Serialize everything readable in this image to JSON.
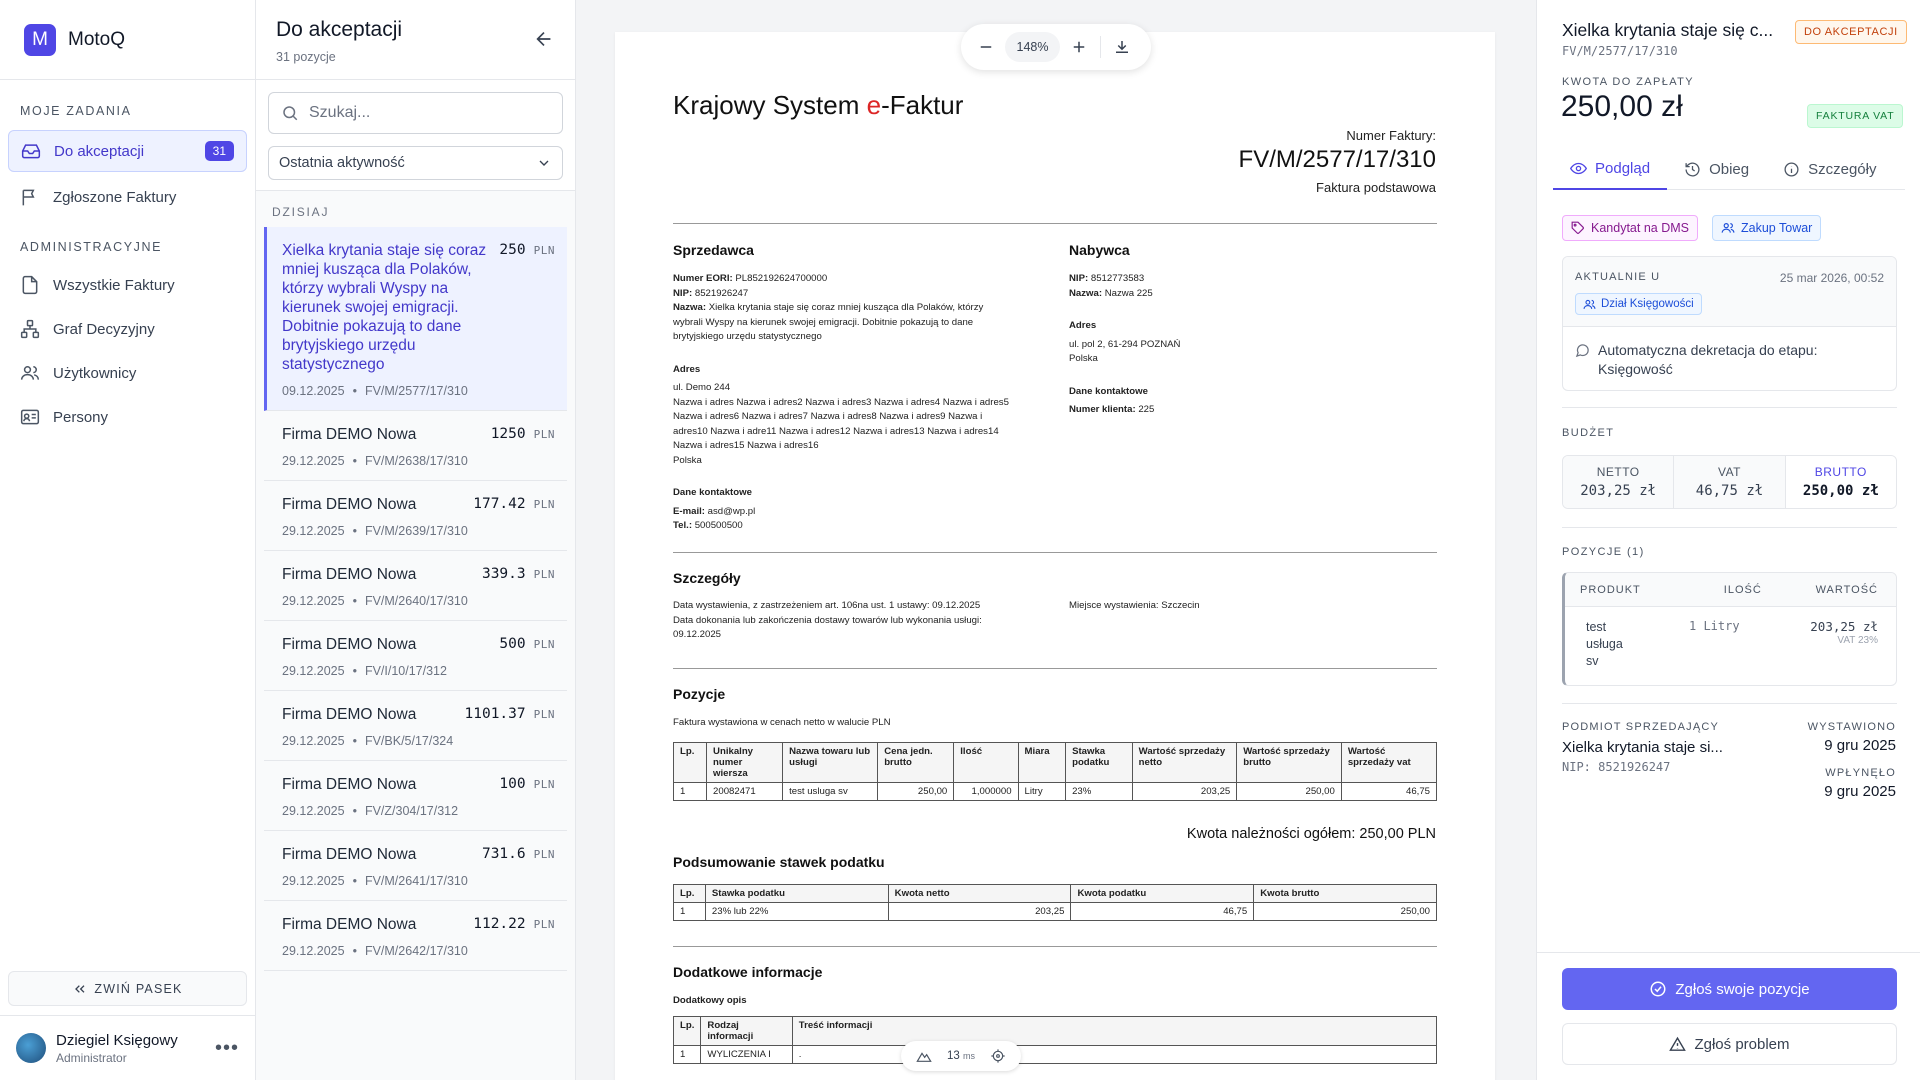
{
  "app": {
    "logo_letter": "M",
    "name": "MotoQ",
    "accent": "#4f46e5"
  },
  "sidebar": {
    "section_tasks": "MOJE ZADANIA",
    "tasks": [
      {
        "label": "Do akceptacji",
        "count": "31",
        "icon": "inbox-icon",
        "active": true
      },
      {
        "label": "Zgłoszone Faktury",
        "icon": "flag-icon"
      }
    ],
    "section_admin": "ADMINISTRACYJNE",
    "admin": [
      {
        "label": "Wszystkie Faktury",
        "icon": "file-icon"
      },
      {
        "label": "Graf Decyzyjny",
        "icon": "network-icon"
      },
      {
        "label": "Użytkownicy",
        "icon": "users-icon"
      },
      {
        "label": "Persony",
        "icon": "id-card-icon"
      }
    ],
    "collapse_label": "ZWIŃ PASEK",
    "user": {
      "name": "Dziegiel Księgowy",
      "role": "Administrator"
    }
  },
  "list": {
    "title": "Do akceptacji",
    "subtitle": "31 pozycje",
    "search_placeholder": "Szukaj...",
    "sort_value": "Ostatnia aktywność",
    "group_label": "DZISIAJ",
    "items": [
      {
        "title": "Xielka krytania staje się coraz mniej kusząca dla Polaków, którzy wybrali Wyspy na kierunek swojej emigracji. Dobitnie pokazują to dane brytyjskiego urzędu statystycznego",
        "amount": "250",
        "currency": "PLN",
        "date": "09.12.2025",
        "number": "FV/M/2577/17/310"
      },
      {
        "title": "Firma DEMO Nowa",
        "amount": "1250",
        "currency": "PLN",
        "date": "29.12.2025",
        "number": "FV/M/2638/17/310"
      },
      {
        "title": "Firma DEMO Nowa",
        "amount": "177.42",
        "currency": "PLN",
        "date": "29.12.2025",
        "number": "FV/M/2639/17/310"
      },
      {
        "title": "Firma DEMO Nowa",
        "amount": "339.3",
        "currency": "PLN",
        "date": "29.12.2025",
        "number": "FV/M/2640/17/310"
      },
      {
        "title": "Firma DEMO Nowa",
        "amount": "500",
        "currency": "PLN",
        "date": "29.12.2025",
        "number": "FV/I/10/17/312"
      },
      {
        "title": "Firma DEMO Nowa",
        "amount": "1101.37",
        "currency": "PLN",
        "date": "29.12.2025",
        "number": "FV/BK/5/17/324"
      },
      {
        "title": "Firma DEMO Nowa",
        "amount": "100",
        "currency": "PLN",
        "date": "29.12.2025",
        "number": "FV/Z/304/17/312"
      },
      {
        "title": "Firma DEMO Nowa",
        "amount": "731.6",
        "currency": "PLN",
        "date": "29.12.2025",
        "number": "FV/M/2641/17/310"
      },
      {
        "title": "Firma DEMO Nowa",
        "amount": "112.22",
        "currency": "PLN",
        "date": "29.12.2025",
        "number": "FV/M/2642/17/310"
      }
    ]
  },
  "viewer": {
    "zoom": "148%",
    "render_time": "13",
    "render_unit": "ms",
    "doc": {
      "title_a": "Krajowy System ",
      "title_e": "e",
      "title_b": "-Faktur",
      "invoice_no_label": "Numer Faktury:",
      "invoice_no": "FV/M/2577/17/310",
      "invoice_kind": "Faktura podstawowa",
      "seller_heading": "Sprzedawca",
      "seller_eori_label": "Numer EORI:",
      "seller_eori": "PL852192624700000",
      "seller_nip_label": "NIP:",
      "seller_nip": "8521926247",
      "seller_name_label": "Nazwa:",
      "seller_name": "Xielka krytania staje się coraz mniej kusząca dla Polaków, którzy wybrali Wyspy na kierunek swojej emigracji. Dobitnie pokazują to dane brytyjskiego urzędu statystycznego",
      "seller_addr_heading": "Adres",
      "seller_addr1": "ul. Demo 244",
      "seller_addr2": "Nazwa i adres Nazwa i adres2 Nazwa i adres3 Nazwa i adres4 Nazwa i adres5 Nazwa i adres6 Nazwa i adres7 Nazwa i adres8 Nazwa i adres9 Nazwa i adres10 Nazwa i adre11 Nazwa i adres12 Nazwa i adres13 Nazwa i adres14 Nazwa i adres15 Nazwa i adres16",
      "seller_country": "Polska",
      "seller_contact_heading": "Dane kontaktowe",
      "seller_email_label": "E-mail:",
      "seller_email": "asd@wp.pl",
      "seller_tel_label": "Tel.:",
      "seller_tel": "500500500",
      "buyer_heading": "Nabywca",
      "buyer_nip_label": "NIP:",
      "buyer_nip": "8512773583",
      "buyer_name_label": "Nazwa:",
      "buyer_name": "Nazwa 225",
      "buyer_addr_heading": "Adres",
      "buyer_addr1": "ul. pol 2, 61-294 POZNAŃ",
      "buyer_country": "Polska",
      "buyer_contact_heading": "Dane kontaktowe",
      "buyer_client_label": "Numer klienta:",
      "buyer_client": "225",
      "details_heading": "Szczegóły",
      "details_issue_label": "Data wystawienia, z zastrzeżeniem art. 106na ust. 1 ustawy:",
      "details_issue": "09.12.2025",
      "details_delivery_label": "Data dokonania lub zakończenia dostawy towarów lub wykonania usługi:",
      "details_delivery": "09.12.2025",
      "details_place_label": "Miejsce wystawienia:",
      "details_place": "Szczecin",
      "positions_heading": "Pozycje",
      "positions_note": "Faktura wystawiona w cenach netto w walucie PLN",
      "positions_cols": [
        "Lp.",
        "Unikalny numer wiersza",
        "Nazwa towaru lub usługi",
        "Cena jedn. brutto",
        "Ilość",
        "Miara",
        "Stawka podatku",
        "Wartość sprzedaży netto",
        "Wartość sprzedaży brutto",
        "Wartość sprzedaży vat"
      ],
      "positions_row": [
        "1",
        "20082471",
        "test usluga sv",
        "250,00",
        "1,000000",
        "Litry",
        "23%",
        "203,25",
        "250,00",
        "46,75"
      ],
      "total_label": "Kwota należności ogółem: 250,00 PLN",
      "tax_heading": "Podsumowanie stawek podatku",
      "tax_cols": [
        "Lp.",
        "Stawka podatku",
        "Kwota netto",
        "Kwota podatku",
        "Kwota brutto"
      ],
      "tax_row": [
        "1",
        "23% lub 22%",
        "203,25",
        "46,75",
        "250,00"
      ],
      "extra_heading": "Dodatkowe informacje",
      "extra_sub": "Dodatkowy opis",
      "extra_cols": [
        "Lp.",
        "Rodzaj informacji",
        "Treść informacji"
      ],
      "extra_row": [
        "1",
        "WYLICZENIA I",
        "."
      ]
    }
  },
  "detail": {
    "title": "Xielka krytania staje się c...",
    "status": "DO AKCEPTACJI",
    "number": "FV/M/2577/17/310",
    "amount_label": "KWOTA DO ZAPŁATY",
    "amount": "250,00 zł",
    "type_badge": "FAKTURA VAT",
    "tabs": [
      {
        "label": "Podgląd",
        "icon": "eye-icon",
        "active": true
      },
      {
        "label": "Obieg",
        "icon": "history-icon"
      },
      {
        "label": "Szczegóły",
        "icon": "info-icon"
      }
    ],
    "chips": [
      "Kandytat na DMS",
      "Zakup Towar"
    ],
    "current": {
      "label": "AKTUALNIE U",
      "date": "25 mar 2026, 00:52",
      "dept": "Dział Księgowości",
      "note": "Automatyczna dekretacja do etapu: Księgowość"
    },
    "budget_label": "BUDŻET",
    "budget": {
      "netto_label": "NETTO",
      "netto": "203,25 zł",
      "vat_label": "VAT",
      "vat": "46,75 zł",
      "brutto_label": "BRUTTO",
      "brutto": "250,00 zł"
    },
    "positions_label": "POZYCJE (1)",
    "positions_cols": [
      "PRODUKT",
      "ILOŚĆ",
      "WARTOŚĆ"
    ],
    "position": {
      "product_l1": "test",
      "product_l2": "usługa",
      "product_l3": "sv",
      "qty": "1 Litry",
      "value": "203,25 zł",
      "vat": "VAT 23%"
    },
    "seller_label": "PODMIOT SPRZEDAJĄCY",
    "seller_name": "Xielka krytania staje si...",
    "seller_nip": "NIP: 8521926247",
    "issued_label": "WYSTAWIONO",
    "issued": "9 gru 2025",
    "received_label": "WPŁYNĘŁO",
    "received": "9 gru 2025",
    "btn_primary": "Zgłoś swoje pozycje",
    "btn_secondary": "Zgłoś problem"
  }
}
